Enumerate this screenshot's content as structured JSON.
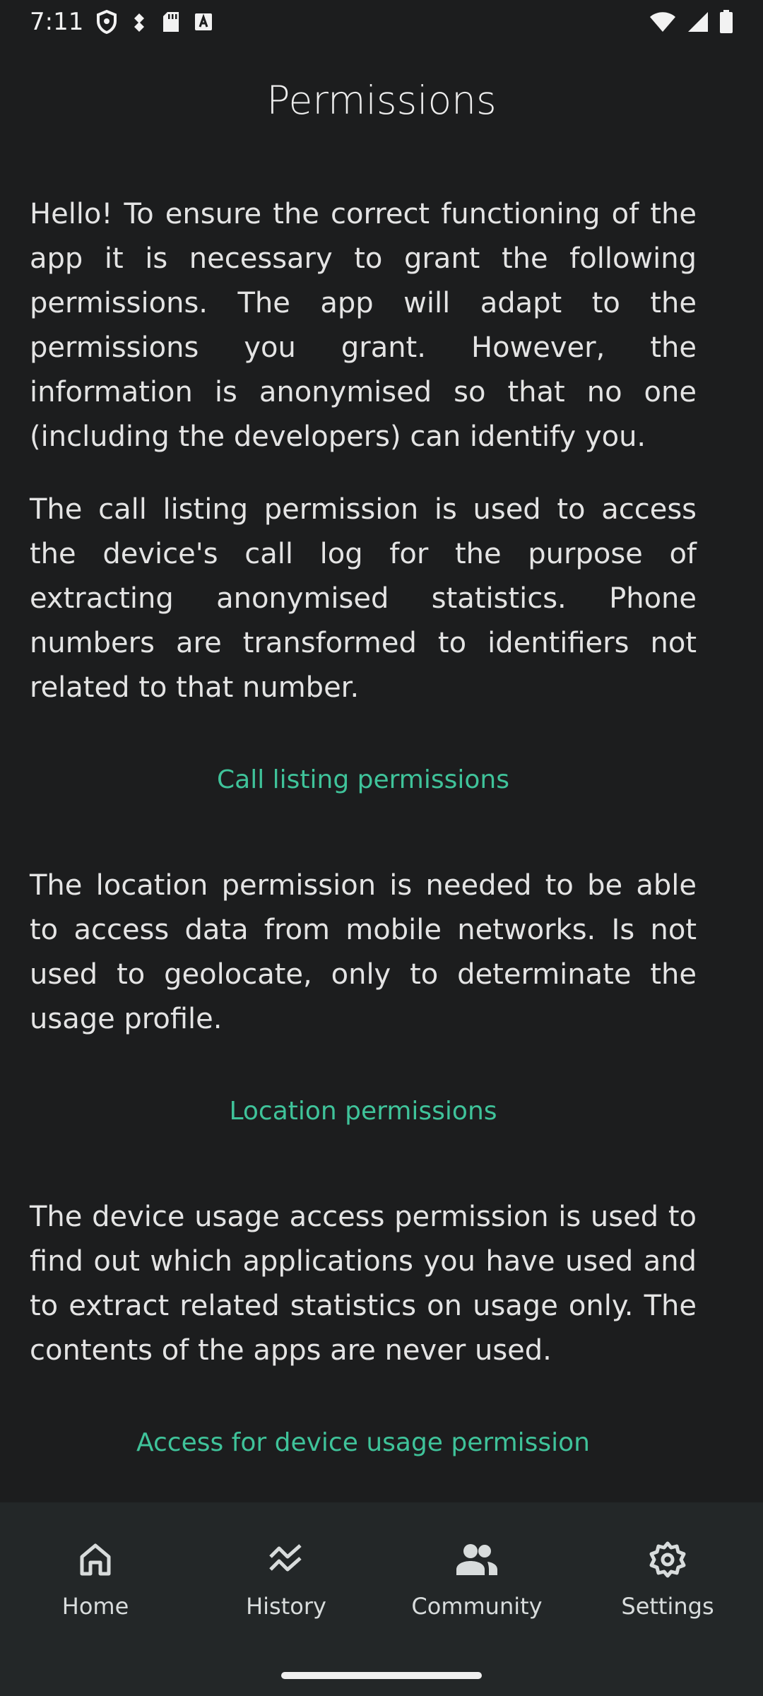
{
  "status_bar": {
    "time": "7:11",
    "left_icons": [
      "shield-icon",
      "usb-debug-icon",
      "sd-card-icon",
      "font-a-icon"
    ],
    "right_icons": [
      "wifi-icon",
      "cellular-signal-icon",
      "battery-icon"
    ]
  },
  "page": {
    "title": "Permissions"
  },
  "content": {
    "intro": "Hello! To ensure the correct functioning of the app it is necessary to grant the following permissions. The app will adapt to the permissions you grant. However, the information is anonymised so that no one (including the developers) can identify you.",
    "call_desc": "The call listing permission is used to access the device's call log for the purpose of extracting anonymised statistics. Phone numbers are transformed to identifiers not related to that number.",
    "call_link": "Call listing permissions",
    "location_desc": "The location permission is needed to be able to access data from mobile networks. Is not used to geolocate, only to determinate the usage profile.",
    "location_link": "Location permissions",
    "usage_desc": "The device usage access permission is used to find out which applications you have used and to extract related statistics on usage only. The contents of the apps are never used.",
    "usage_link": "Access for device usage permission"
  },
  "bottom_nav": {
    "items": [
      {
        "label": "Home",
        "icon": "home-icon"
      },
      {
        "label": "History",
        "icon": "history-icon"
      },
      {
        "label": "Community",
        "icon": "community-icon"
      },
      {
        "label": "Settings",
        "icon": "settings-icon"
      }
    ]
  },
  "colors": {
    "background": "#1c1d1e",
    "accent": "#3fc39a",
    "nav_background": "#232728"
  }
}
